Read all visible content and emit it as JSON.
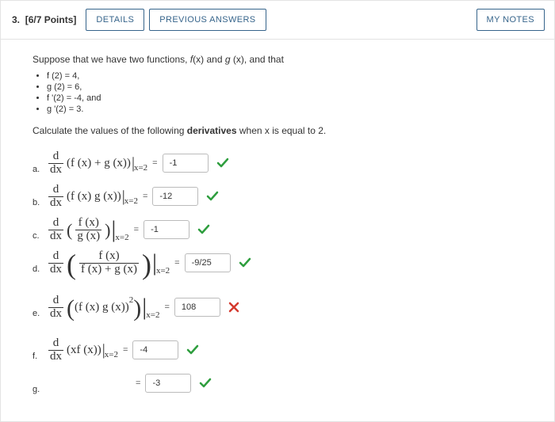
{
  "header": {
    "qnum": "3.",
    "points_label": "[6/7 Points]",
    "details": "DETAILS",
    "previous": "PREVIOUS ANSWERS",
    "mynotes": "MY NOTES"
  },
  "prompt": {
    "pre": "Suppose that we have two functions, ",
    "f": "f",
    "paren1": "(x)",
    "and1": " and ",
    "g": "g",
    "paren2": " (x)",
    "post": ", and that"
  },
  "given": [
    "f (2) = 4,",
    "g (2) = 6,",
    "f '(2) = -4, and",
    "g '(2) = 3."
  ],
  "calc": {
    "pre": "Calculate the values of the following ",
    "bold": "derivatives",
    "post": " when x is equal to 2."
  },
  "ddx": {
    "d": "d",
    "dx": "dx"
  },
  "at2": "x=2",
  "rows": {
    "a": {
      "label": "a.",
      "expr": "(f (x) + g (x))",
      "ans": "-1",
      "correct": true
    },
    "b": {
      "label": "b.",
      "expr": "(f (x) g (x))",
      "ans": "-12",
      "correct": true
    },
    "c": {
      "label": "c.",
      "num": "f (x)",
      "den": "g (x)",
      "ans": "-1",
      "correct": true
    },
    "d": {
      "label": "d.",
      "num": "f (x)",
      "den": "f (x) + g (x)",
      "ans": "-9/25",
      "correct": true
    },
    "e": {
      "label": "e.",
      "inner": "(f (x) g (x))",
      "sq": "2",
      "ans": "108",
      "correct": false
    },
    "f": {
      "label": "f.",
      "expr": "(xf (x))",
      "ans": "-4",
      "correct": true
    },
    "g": {
      "label": "g.",
      "ans": "-3",
      "correct": true
    }
  }
}
